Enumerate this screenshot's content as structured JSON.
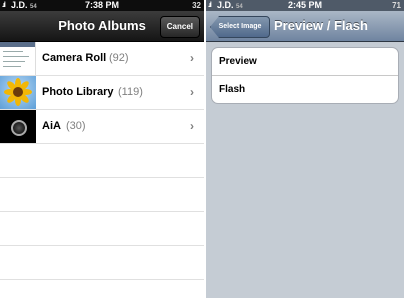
{
  "left": {
    "status": {
      "carrier": "J.D.",
      "signal_num": "54",
      "time": "7:38 PM",
      "battery": "32"
    },
    "nav": {
      "title": "Photo Albums",
      "cancel_label": "Cancel"
    },
    "albums": [
      {
        "name": "Camera Roll",
        "count": "(92)"
      },
      {
        "name": "Photo Library",
        "count": "(119)"
      },
      {
        "name": "AiA",
        "count": "(30)"
      }
    ],
    "chevron": "›"
  },
  "right": {
    "status": {
      "carrier": "J.D.",
      "signal_num": "54",
      "time": "2:45 PM",
      "battery": "71"
    },
    "nav": {
      "title": "Preview / Flash",
      "back_label": "Select Image"
    },
    "options": [
      "Preview",
      "Flash"
    ]
  },
  "colors": {
    "left_navbar": "#1a1a1a",
    "right_navbar": "#6f84a0",
    "right_background": "#c5ccd4",
    "count_gray": "#7f7f7f"
  },
  "icons": [
    "signal-bars-icon",
    "chevron-right-icon",
    "camera-roll-thumbnail",
    "sunflower-thumbnail",
    "aia-disc-thumbnail"
  ]
}
